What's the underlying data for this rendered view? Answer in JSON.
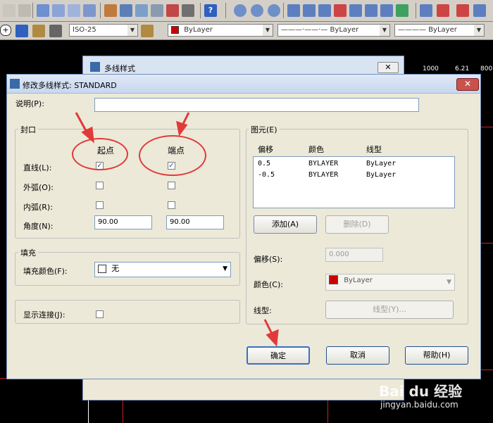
{
  "toolbar2": {
    "dimstyle_value": "ISO-25",
    "color_value": "ByLayer",
    "linetype_value": "ByLayer",
    "lineweight_value": "ByLayer"
  },
  "parent_dialog": {
    "title": "多线样式"
  },
  "ruler": {
    "a": "1000",
    "b": "6.21",
    "c": "800"
  },
  "dialog": {
    "title": "修改多线样式: STANDARD",
    "description_label": "说明(P):",
    "description_value": "",
    "caps": {
      "group_label": "封口",
      "start_header": "起点",
      "end_header": "端点",
      "rows": [
        {
          "label": "直线(L):",
          "start_checked": "✓",
          "end_checked": "✓"
        },
        {
          "label": "外弧(O):",
          "start_checked": "",
          "end_checked": ""
        },
        {
          "label": "内弧(R):",
          "start_checked": "",
          "end_checked": ""
        }
      ],
      "angle_label": "角度(N):",
      "angle_start": "90.00",
      "angle_end": "90.00"
    },
    "fill": {
      "group_label": "填充",
      "color_label": "填充颜色(F):",
      "color_value": "无"
    },
    "joints": {
      "label": "显示连接(J):",
      "checked": ""
    },
    "elements": {
      "group_label": "图元(E)",
      "columns": [
        "偏移",
        "颜色",
        "线型"
      ],
      "rows": [
        {
          "offset": "0.5",
          "color": "BYLAYER",
          "linetype": "ByLayer"
        },
        {
          "offset": "-0.5",
          "color": "BYLAYER",
          "linetype": "ByLayer"
        }
      ],
      "add_button": "添加(A)",
      "delete_button": "删除(D)",
      "offset_label": "偏移(S):",
      "offset_value": "0.000",
      "color_label": "颜色(C):",
      "color_value": "ByLayer",
      "linetype_label": "线型:",
      "linetype_button": "线型(Y)..."
    },
    "ok_button": "确定",
    "cancel_button": "取消",
    "help_button": "帮助(H)"
  },
  "watermark": {
    "logo": "Bai du 经验",
    "url": "jingyan.baidu.com"
  },
  "colors": {
    "annotation_red": "#e03a3a",
    "color_swatch_red": "#cc0000"
  }
}
